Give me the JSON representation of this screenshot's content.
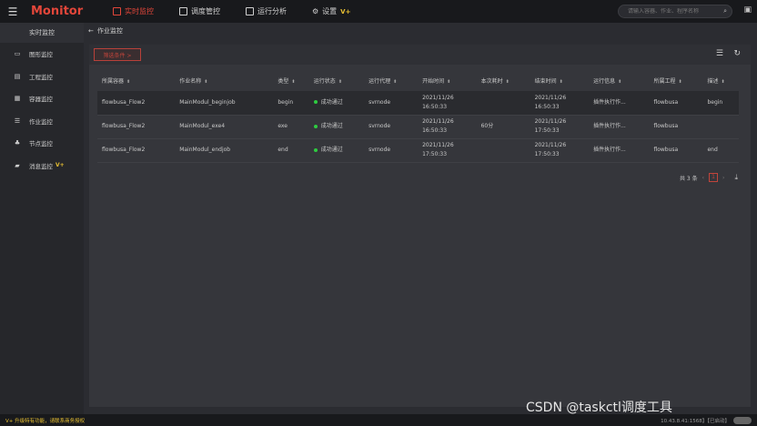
{
  "topbar": {
    "app_title": "Monitor",
    "nav": [
      {
        "label": "实时监控",
        "icon": "monitor-icon",
        "active": true
      },
      {
        "label": "调度管控",
        "icon": "calendar-icon",
        "active": false
      },
      {
        "label": "运行分析",
        "icon": "chart-icon",
        "active": false
      },
      {
        "label": "设置",
        "icon": "gear-icon",
        "active": false,
        "badge": "V+"
      }
    ],
    "search_placeholder": "请输入容器、作业、程序名称",
    "accent_color": "#e3463a"
  },
  "sidebar": {
    "title": "实时监控",
    "items": [
      {
        "label": "图形监控",
        "icon": "display-icon"
      },
      {
        "label": "工程监控",
        "icon": "project-icon"
      },
      {
        "label": "容器监控",
        "icon": "container-icon"
      },
      {
        "label": "作业监控",
        "icon": "list-icon"
      },
      {
        "label": "节点监控",
        "icon": "node-icon"
      },
      {
        "label": "消息监控",
        "icon": "message-icon",
        "badge": "V+"
      }
    ]
  },
  "breadcrumb": {
    "back_label": "作业监控"
  },
  "toolbar": {
    "filter_label": "筛选条件 >"
  },
  "table": {
    "columns": [
      "所属容器",
      "作业名称",
      "类型",
      "运行状态",
      "运行代理",
      "开始时间",
      "本次耗时",
      "结束时间",
      "运行信息",
      "所属工程",
      "描述"
    ],
    "rows": [
      {
        "container": "flowbusa_Flow2",
        "name": "MainModul_beginjob",
        "type": "begin",
        "status": "成功通过",
        "agent": "svrnode",
        "start": "2021/11/26\n16:50:33",
        "duration": "",
        "end": "2021/11/26\n16:50:33",
        "info": "插件执行作...",
        "project": "flowbusa",
        "desc": "begin"
      },
      {
        "container": "flowbusa_Flow2",
        "name": "MainModul_exe4",
        "type": "exe",
        "status": "成功通过",
        "agent": "svrnode",
        "start": "2021/11/26\n16:50:33",
        "duration": "60分",
        "end": "2021/11/26\n17:50:33",
        "info": "插件执行作...",
        "project": "flowbusa",
        "desc": ""
      },
      {
        "container": "flowbusa_Flow2",
        "name": "MainModul_endjob",
        "type": "end",
        "status": "成功通过",
        "agent": "svrnode",
        "start": "2021/11/26\n17:50:33",
        "duration": "",
        "end": "2021/11/26\n17:50:33",
        "info": "插件执行作...",
        "project": "flowbusa",
        "desc": "end"
      }
    ]
  },
  "pagination": {
    "total_label": "共 3 条",
    "page": "1"
  },
  "footer": {
    "note": "V+ 升级特有功能，请联系商务授权",
    "status": "10.43.8.41:1568】【已启动】"
  },
  "watermark": "CSDN @taskctl调度工具",
  "status_color": "#2ecc40"
}
